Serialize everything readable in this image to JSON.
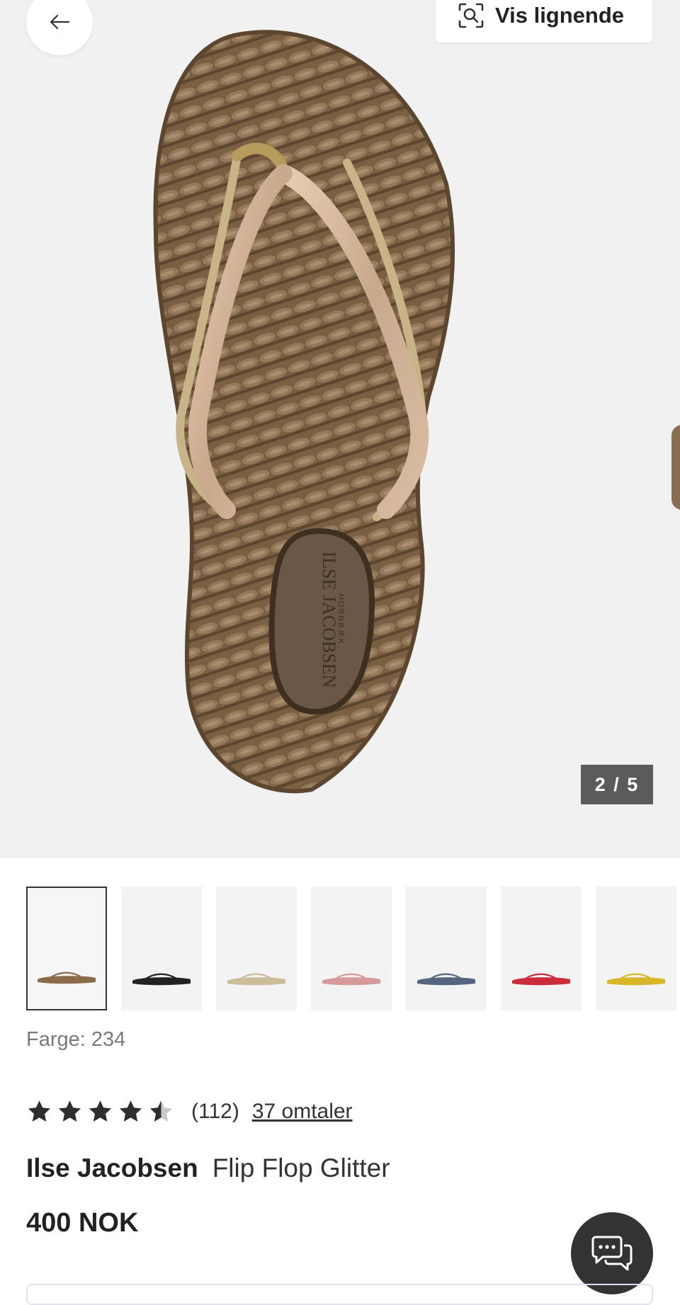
{
  "header": {
    "back_icon": "arrow-left-icon",
    "similar_button": {
      "icon": "image-search-icon",
      "label": "Vis lignende"
    }
  },
  "gallery": {
    "counter": "2 / 5",
    "thumbnails": [
      {
        "color": "#8a6a48",
        "selected": true
      },
      {
        "color": "#222222",
        "selected": false
      },
      {
        "color": "#cbbd98",
        "selected": false
      },
      {
        "color": "#d79a9a",
        "selected": false
      },
      {
        "color": "#56657f",
        "selected": false
      },
      {
        "color": "#cc2b3b",
        "selected": false
      },
      {
        "color": "#d9b52a",
        "selected": false
      }
    ]
  },
  "product": {
    "color_label": "Farge: 234",
    "rating": {
      "value": 4.5,
      "max": 5,
      "count": "(112)",
      "reviews_link": "37 omtaler"
    },
    "brand": "Ilse Jacobsen",
    "name": "Flip Flop Glitter",
    "price": "400 NOK",
    "sole_logo": {
      "line1": "ILSE JACOBSEN",
      "line2": "HORNBÆK"
    }
  },
  "chat": {
    "icon": "chat-bubbles-icon"
  }
}
